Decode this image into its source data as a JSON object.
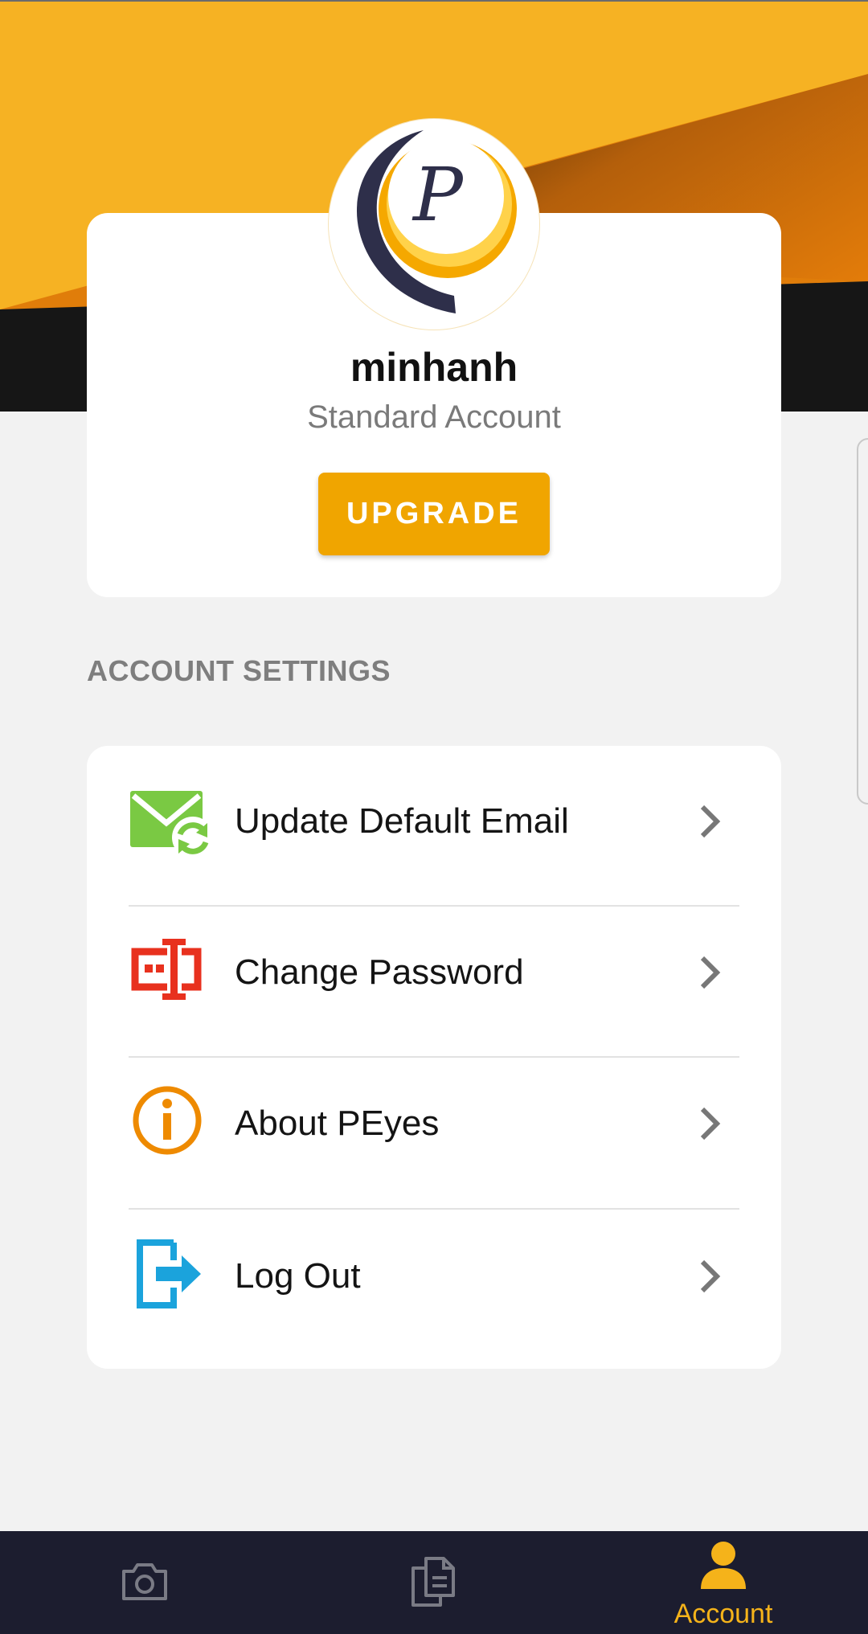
{
  "profile": {
    "username": "minhanh",
    "account_type": "Standard Account",
    "upgrade_label": "UPGRADE",
    "avatar_letter": "P"
  },
  "settings": {
    "heading": "ACCOUNT SETTINGS",
    "items": [
      {
        "label": "Update Default Email",
        "icon": "email-sync-icon",
        "icon_color": "#7ac943"
      },
      {
        "label": "Change Password",
        "icon": "password-field-icon",
        "icon_color": "#e8311e"
      },
      {
        "label": "About PEyes",
        "icon": "info-icon",
        "icon_color": "#ee8a00"
      },
      {
        "label": "Log Out",
        "icon": "logout-icon",
        "icon_color": "#1ba3dc"
      }
    ]
  },
  "bottom_nav": {
    "tabs": [
      {
        "label": "",
        "icon": "camera-icon",
        "active": false
      },
      {
        "label": "",
        "icon": "documents-icon",
        "active": false
      },
      {
        "label": "Account",
        "icon": "account-icon",
        "active": true
      }
    ]
  },
  "colors": {
    "accent": "#f0a500",
    "header_yellow": "#f6b223",
    "header_orange": "#e07d0a",
    "header_dark": "#161616",
    "nav_background": "#1c1d2f",
    "nav_active": "#f5b31a",
    "nav_inactive": "#7a7b85"
  }
}
